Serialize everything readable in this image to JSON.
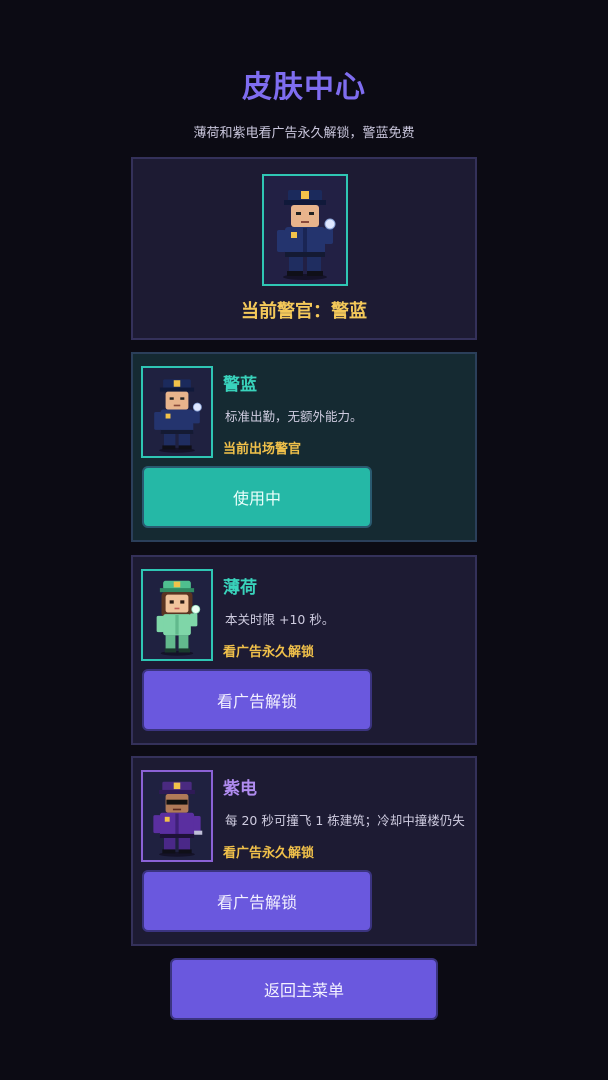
{
  "header": {
    "title": "皮肤中心",
    "subtitle": "薄荷和紫电看广告永久解锁，警蓝免费"
  },
  "current": {
    "label": "当前警官：警蓝",
    "icon": "police-blue-portrait"
  },
  "skins": [
    {
      "name": "警蓝",
      "description": "标准出勤，无额外能力。",
      "status": "当前出场警官",
      "button": "使用中",
      "icon": "police-blue-portrait",
      "accent": "#39d3bc"
    },
    {
      "name": "薄荷",
      "description": "本关时限 +10 秒。",
      "status": "看广告永久解锁",
      "button": "看广告解锁",
      "icon": "police-mint-portrait",
      "accent": "#39d3bc"
    },
    {
      "name": "紫电",
      "description": "每 20 秒可撞飞 1 栋建筑；冷却中撞楼仍失",
      "status": "看广告永久解锁",
      "button": "看广告解锁",
      "icon": "police-purple-portrait",
      "accent": "#b08cf0"
    }
  ],
  "footer": {
    "back_label": "返回主菜单"
  },
  "colors": {
    "background": "#0c0b14",
    "title": "#7f6df0",
    "gold": "#f4c95a",
    "teal": "#2fc6b4",
    "violet": "#6a58de"
  }
}
